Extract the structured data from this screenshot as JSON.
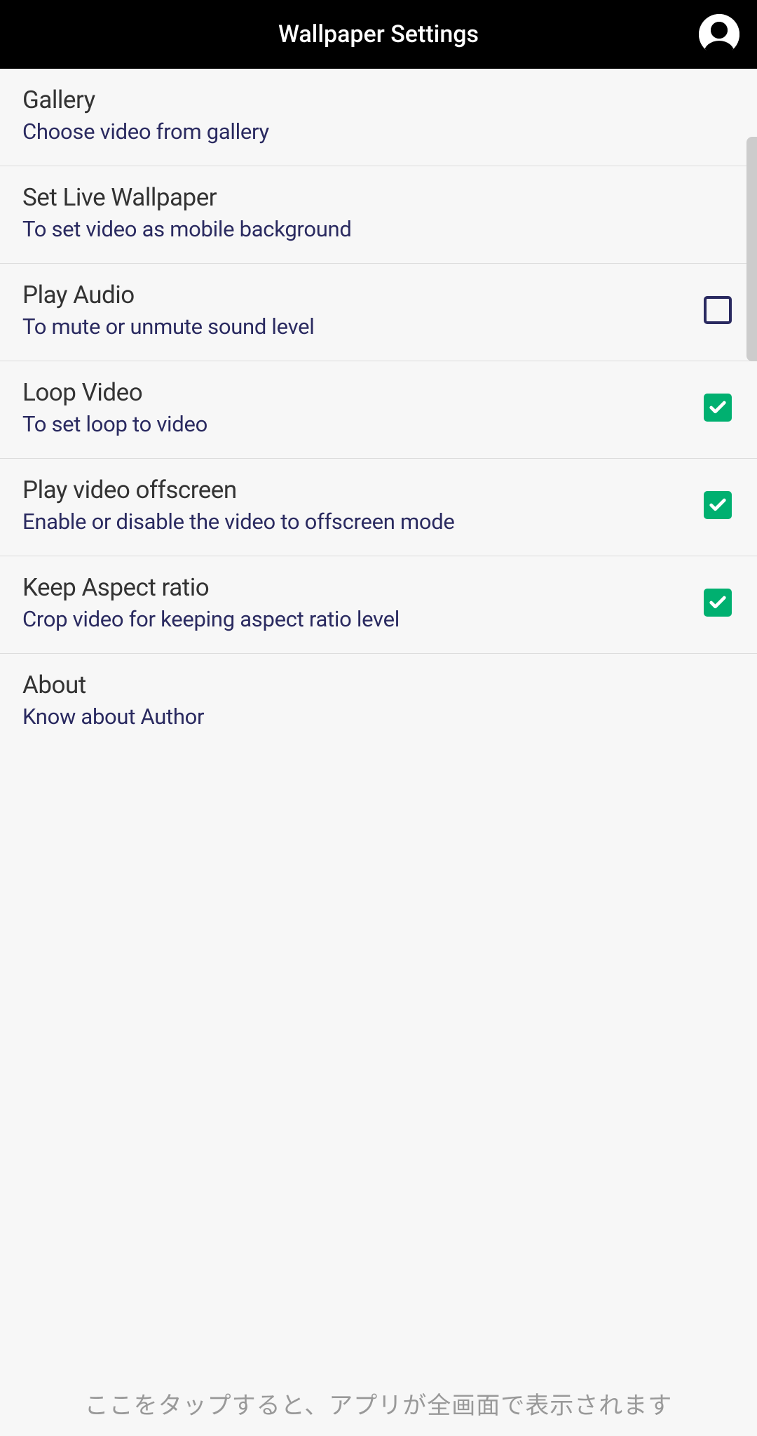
{
  "header": {
    "title": "Wallpaper Settings"
  },
  "settings": [
    {
      "title": "Gallery",
      "subtitle": "Choose video from gallery",
      "hasCheckbox": false
    },
    {
      "title": "Set Live Wallpaper",
      "subtitle": "To set video as mobile background",
      "hasCheckbox": false
    },
    {
      "title": "Play Audio",
      "subtitle": "To mute or unmute sound level",
      "hasCheckbox": true,
      "checked": false
    },
    {
      "title": "Loop Video",
      "subtitle": "To set loop to video",
      "hasCheckbox": true,
      "checked": true
    },
    {
      "title": "Play video offscreen",
      "subtitle": "Enable or disable the video to offscreen mode",
      "hasCheckbox": true,
      "checked": true
    },
    {
      "title": "Keep Aspect ratio",
      "subtitle": "Crop video for keeping aspect ratio level",
      "hasCheckbox": true,
      "checked": true
    },
    {
      "title": "About",
      "subtitle": "Know about Author",
      "hasCheckbox": false
    }
  ],
  "footer": {
    "hint": "ここをタップすると、アプリが全画面で表示されます"
  }
}
